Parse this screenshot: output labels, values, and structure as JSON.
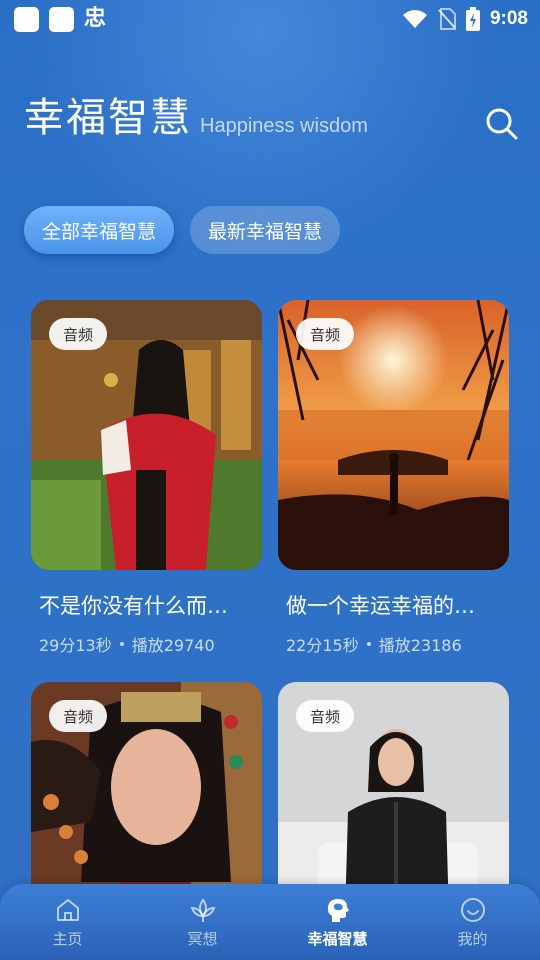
{
  "status_bar": {
    "app_glyph": "忠",
    "time": "9:08"
  },
  "header": {
    "title": "幸福智慧",
    "subtitle": "Happiness wisdom"
  },
  "tabs": [
    {
      "label": "全部幸福智慧",
      "active": true
    },
    {
      "label": "最新幸福智慧",
      "active": false
    }
  ],
  "cards": [
    {
      "badge": "音频",
      "title": "不是你没有什么而…",
      "duration": "29分13秒",
      "plays": "播放29740"
    },
    {
      "badge": "音频",
      "title": "做一个幸运幸福的…",
      "duration": "22分15秒",
      "plays": "播放23186"
    },
    {
      "badge": "音频"
    },
    {
      "badge": "音频"
    }
  ],
  "nav": [
    {
      "label": "主页",
      "icon": "home-icon",
      "active": false
    },
    {
      "label": "冥想",
      "icon": "lotus-icon",
      "active": false
    },
    {
      "label": "幸福智慧",
      "icon": "head-brain-icon",
      "active": true
    },
    {
      "label": "我的",
      "icon": "smiley-icon",
      "active": false
    }
  ],
  "colors": {
    "background": "#2e73c9",
    "active_tab": "#5aa2f0",
    "nav_bar": "#3170c8"
  }
}
